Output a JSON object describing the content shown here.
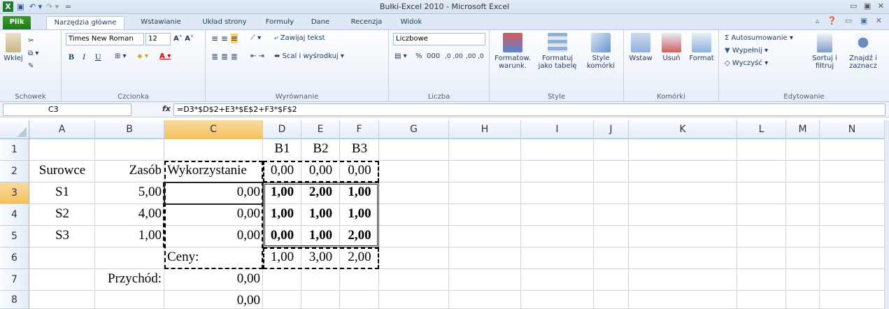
{
  "window": {
    "title": "Bułki-Excel 2010 - Microsoft Excel",
    "controls": "▭ ▣ ✕"
  },
  "qat": {
    "app_icon": "X",
    "save": "▣",
    "undo": "↶ ▾",
    "redo": "↷ ▾",
    "customize": "="
  },
  "tabs": [
    "Plik",
    "Narzędzia główne",
    "Wstawianie",
    "Układ strony",
    "Formuły",
    "Dane",
    "Recenzja",
    "Widok"
  ],
  "tab_controls": "▵ ❓ ▭ ▣ ✕",
  "ribbon": {
    "clipboard": {
      "label": "Schowek",
      "paste": "Wklej"
    },
    "font": {
      "label": "Czcionka",
      "name": "Times New Roman",
      "size": "12",
      "bold": "B",
      "italic": "I",
      "underline": "U"
    },
    "alignment": {
      "label": "Wyrównanie",
      "wrap": "Zawijaj tekst",
      "merge": "Scal i wyśrodkuj"
    },
    "number": {
      "label": "Liczba",
      "format": "Liczbowe",
      "percent": "%",
      "thousands": "000",
      "inc": ",0 ,00",
      "dec": ",00 ,0"
    },
    "styles": {
      "label": "Style",
      "cond": "Formatow. warunk.",
      "table": "Formatuj jako tabelę",
      "cell": "Style komórki"
    },
    "cells": {
      "label": "Komórki",
      "insert": "Wstaw",
      "delete": "Usuń",
      "format": "Format"
    },
    "editing": {
      "label": "Edytowanie",
      "autosum": "Σ Autosumowanie",
      "fill": "Wypełnij",
      "clear": "Wyczyść",
      "sort": "Sortuj i filtruj",
      "find": "Znajdź i zaznacz"
    }
  },
  "namebox": "C3",
  "fx": "fx",
  "formula": "=D3*$D$2+E3*$E$2+F3*$F$2",
  "columns": [
    "A",
    "B",
    "C",
    "D",
    "E",
    "F",
    "G",
    "H",
    "I",
    "J",
    "K",
    "L",
    "M",
    "N"
  ],
  "rows": [
    "1",
    "2",
    "3",
    "4",
    "5",
    "6",
    "7",
    "8"
  ],
  "cells": {
    "D1": "B1",
    "E1": "B2",
    "F1": "B3",
    "A2": "Surowce",
    "B2": "Zasób",
    "C2": "Wykorzystanie",
    "D2": "0,00",
    "E2": "0,00",
    "F2": "0,00",
    "A3": "S1",
    "B3": "5,00",
    "C3": "0,00",
    "D3": "1,00",
    "E3": "2,00",
    "F3": "1,00",
    "A4": "S2",
    "B4": "4,00",
    "C4": "0,00",
    "D4": "1,00",
    "E4": "1,00",
    "F4": "1,00",
    "A5": "S3",
    "B5": "1,00",
    "C5": "0,00",
    "D5": "0,00",
    "E5": "1,00",
    "F5": "2,00",
    "C6": "Ceny:",
    "D6": "1,00",
    "E6": "3,00",
    "F6": "2,00",
    "B7": "Przychód:",
    "C7": "0,00",
    "C8": "0,00"
  }
}
